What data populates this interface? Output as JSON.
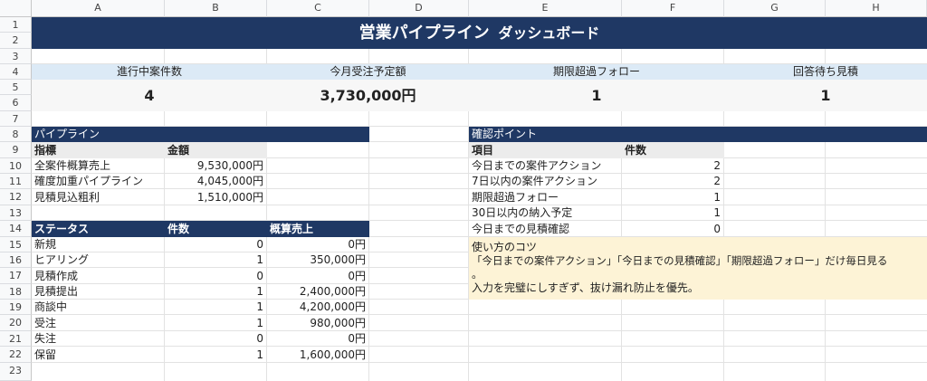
{
  "columns": [
    "A",
    "B",
    "C",
    "D",
    "E",
    "F",
    "G",
    "H"
  ],
  "rows": [
    "1",
    "2",
    "3",
    "4",
    "5",
    "6",
    "7",
    "8",
    "9",
    "10",
    "11",
    "12",
    "13",
    "14",
    "15",
    "16",
    "17",
    "18",
    "19",
    "20",
    "21",
    "22",
    "23"
  ],
  "title": {
    "main": "営業パイプライン",
    "sub": "ダッシュボード"
  },
  "kpis": [
    {
      "label": "進行中案件数",
      "value": "4"
    },
    {
      "label": "今月受注予定額",
      "value": "3,730,000円"
    },
    {
      "label": "期限超過フォロー",
      "value": "1"
    },
    {
      "label": "回答待ち見積",
      "value": "1"
    }
  ],
  "pipeline": {
    "section_title": "パイプライン",
    "headers": [
      "指標",
      "金額"
    ],
    "rows": [
      {
        "label": "全案件概算売上",
        "value": "9,530,000円"
      },
      {
        "label": "確度加重パイプライン",
        "value": "4,045,000円"
      },
      {
        "label": "見積見込粗利",
        "value": "1,510,000円"
      }
    ]
  },
  "status": {
    "headers": [
      "ステータス",
      "件数",
      "概算売上"
    ],
    "rows": [
      {
        "label": "新規",
        "count": "0",
        "amount": "0円"
      },
      {
        "label": "ヒアリング",
        "count": "1",
        "amount": "350,000円"
      },
      {
        "label": "見積作成",
        "count": "0",
        "amount": "0円"
      },
      {
        "label": "見積提出",
        "count": "1",
        "amount": "2,400,000円"
      },
      {
        "label": "商談中",
        "count": "1",
        "amount": "4,200,000円"
      },
      {
        "label": "受注",
        "count": "1",
        "amount": "980,000円"
      },
      {
        "label": "失注",
        "count": "0",
        "amount": "0円"
      },
      {
        "label": "保留",
        "count": "1",
        "amount": "1,600,000円"
      }
    ]
  },
  "checkpoints": {
    "section_title": "確認ポイント",
    "headers": [
      "項目",
      "件数"
    ],
    "rows": [
      {
        "label": "今日までの案件アクション",
        "count": "2"
      },
      {
        "label": "7日以内の案件アクション",
        "count": "2"
      },
      {
        "label": "期限超過フォロー",
        "count": "1"
      },
      {
        "label": "30日以内の納入予定",
        "count": "1"
      },
      {
        "label": "今日までの見積確認",
        "count": "0"
      }
    ]
  },
  "tips": {
    "title": "使い方のコツ",
    "line1": "「今日までの案件アクション」「今日までの見積確認」「期限超過フォロー」だけ毎日見る",
    "line2": "。",
    "line3": "入力を完璧にしすぎず、抜け漏れ防止を優先。"
  },
  "colors": {
    "navy": "#1f3864",
    "kpi_band": "#dceaf6",
    "header_gray": "#ececec",
    "tips_bg": "#fdf3d6"
  }
}
